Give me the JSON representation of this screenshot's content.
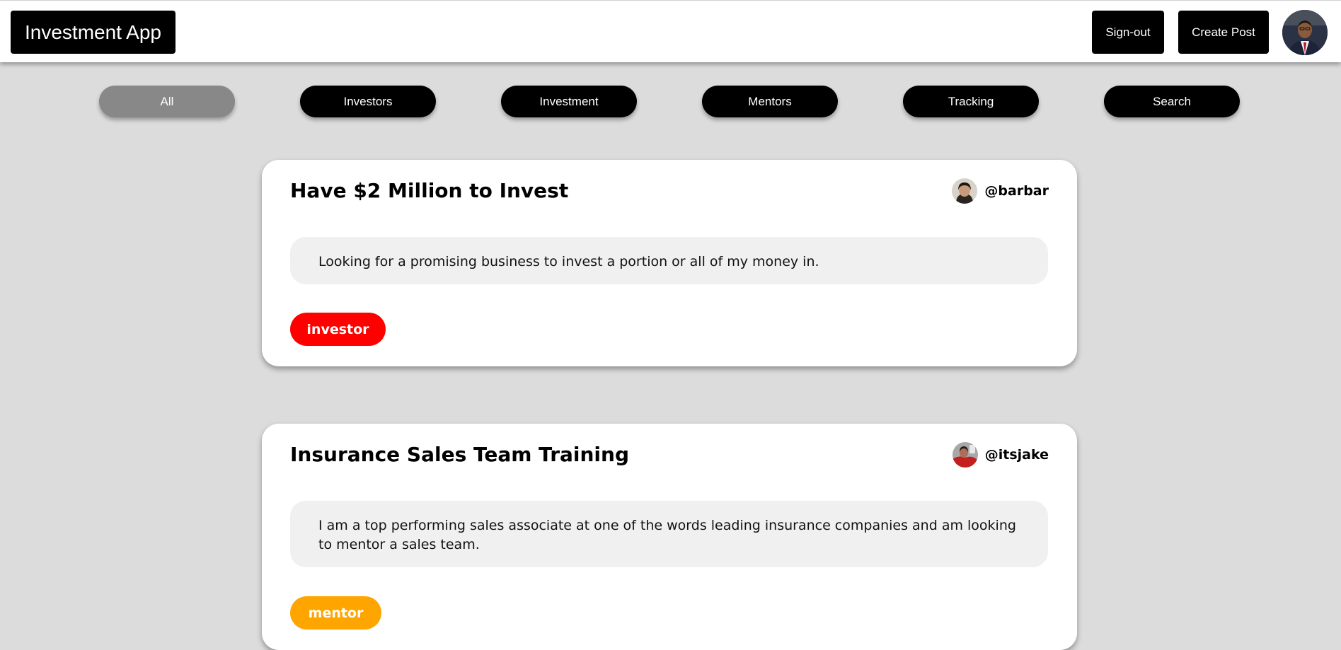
{
  "header": {
    "brand": "Investment App",
    "signout_label": "Sign-out",
    "create_post_label": "Create Post",
    "avatar_icon": "user-profile-photo"
  },
  "filters": [
    {
      "label": "All",
      "active": true
    },
    {
      "label": "Investors",
      "active": false
    },
    {
      "label": "Investment",
      "active": false
    },
    {
      "label": "Mentors",
      "active": false
    },
    {
      "label": "Tracking",
      "active": false
    },
    {
      "label": "Search",
      "active": false
    }
  ],
  "posts": [
    {
      "title": "Have $2 Million to Invest",
      "author": "@barbar",
      "body": "Looking for a promising business to invest a portion or all of my money in.",
      "tag": "investor",
      "tag_color": "#ff0000"
    },
    {
      "title": "Insurance Sales Team Training",
      "author": "@itsjake",
      "body": "I am a top performing sales associate at one of the words leading insurance companies and am looking to mentor a sales team.",
      "tag": "mentor",
      "tag_color": "#ffa500"
    }
  ],
  "colors": {
    "background": "#dcdcdc",
    "button": "#000000",
    "active_filter": "#888888"
  }
}
